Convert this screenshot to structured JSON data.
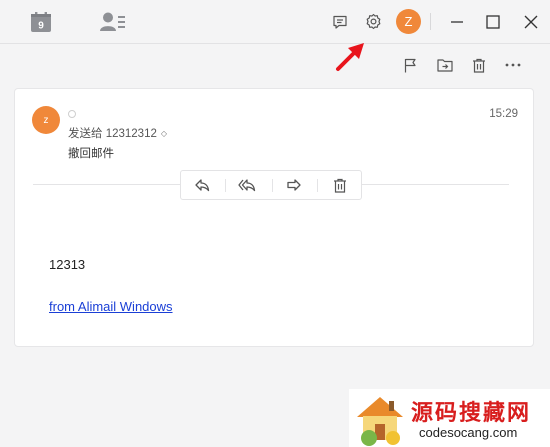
{
  "topbar": {
    "left_icons": [
      "calendar-icon",
      "contacts-icon"
    ],
    "calendar_day": "9",
    "right_icons": [
      "chat-icon",
      "settings-icon"
    ],
    "avatar_letter": "Z",
    "window_controls": [
      "minimize-icon",
      "maximize-icon",
      "close-icon"
    ]
  },
  "toolbar": {
    "icons": [
      "flag-icon",
      "move-to-folder-icon",
      "delete-icon",
      "more-icon"
    ]
  },
  "message": {
    "avatar_letter": "z",
    "recipient_line": "发送给 12312312",
    "subject": "撤回邮件",
    "time": "15:29",
    "actions": [
      "reply-icon",
      "reply-all-icon",
      "forward-icon",
      "delete-icon"
    ],
    "body_text": "12313",
    "body_link": "from Alimail Windows"
  },
  "watermark": {
    "title": "源码搜藏网",
    "url": "codesocang.com"
  },
  "colors": {
    "accent": "#f0883a",
    "link": "#1a3fd6",
    "watermark_red": "#d81e1e",
    "annotation_arrow": "#e8141c"
  }
}
